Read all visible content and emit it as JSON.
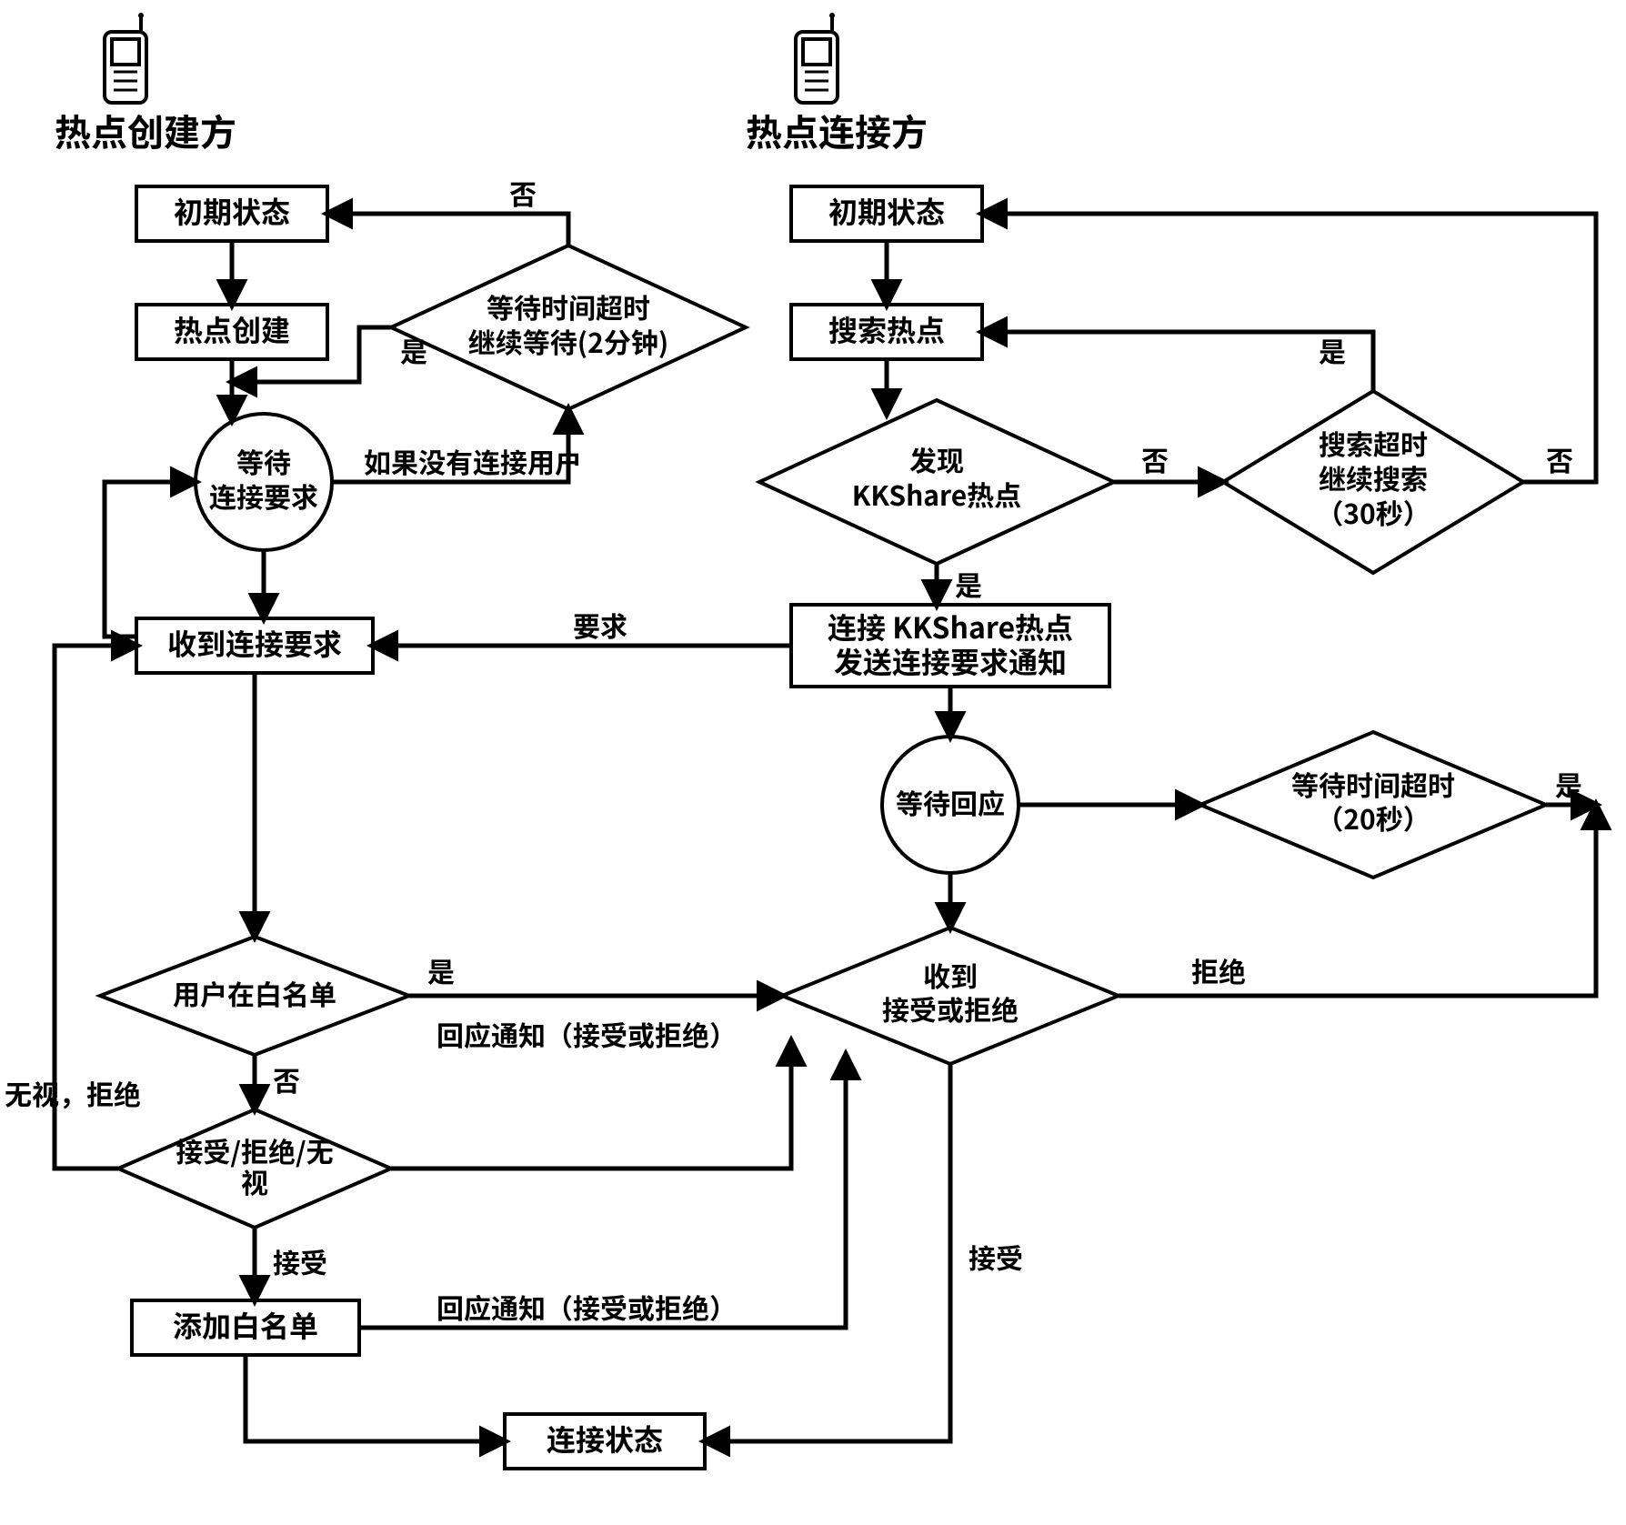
{
  "titles": {
    "creator": "热点创建方",
    "client": "热点连接方"
  },
  "nodes": {
    "c_init": "初期状态",
    "c_create": "热点创建",
    "c_wait_l1": "等待",
    "c_wait_l2": "连接要求",
    "c_recv": "收到连接要求",
    "c_inlist": "用户在白名单",
    "c_decide_l1": "接受/拒绝/无",
    "c_decide_l2": "视",
    "c_addlist": "添加白名单",
    "c_connected": "连接状态",
    "c_timeout_l1": "等待时间超时",
    "c_timeout_l2": "继续等待(2分钟)",
    "r_init": "初期状态",
    "r_search": "搜索热点",
    "r_found_l1": "发现",
    "r_found_l2": "KKShare热点",
    "r_connect_l1": "连接 KKShare热点",
    "r_connect_l2": "发送连接要求通知",
    "r_wait": "等待回应",
    "r_recv_l1": "收到",
    "r_recv_l2": "接受或拒绝",
    "r_sto_l1": "搜索超时",
    "r_sto_l2": "继续搜索",
    "r_sto_l3": "（30秒）",
    "r_wto_l1": "等待时间超时",
    "r_wto_l2": "（20秒）"
  },
  "edges": {
    "no": "否",
    "yes": "是",
    "no_user": "如果没有连接用户",
    "request": "要求",
    "resp_notify": "回应通知（接受或拒绝）",
    "ignore_reject": "无视，拒绝",
    "accept": "接受",
    "reject": "拒绝"
  }
}
